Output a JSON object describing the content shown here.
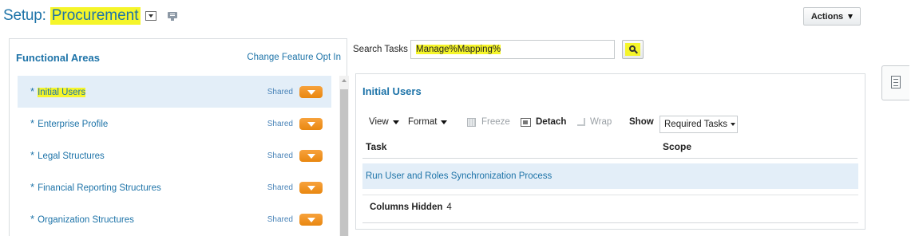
{
  "header": {
    "title_prefix": "Setup:",
    "title_name": "Procurement",
    "actions_label": "Actions"
  },
  "functional_areas": {
    "title": "Functional Areas",
    "change_link": "Change Feature Opt In",
    "items": [
      {
        "star": "*",
        "label": "Initial Users",
        "shared": "Shared",
        "selected": true
      },
      {
        "star": "*",
        "label": "Enterprise Profile",
        "shared": "Shared",
        "selected": false
      },
      {
        "star": "*",
        "label": "Legal Structures",
        "shared": "Shared",
        "selected": false
      },
      {
        "star": "*",
        "label": "Financial Reporting Structures",
        "shared": "Shared",
        "selected": false
      },
      {
        "star": "*",
        "label": "Organization Structures",
        "shared": "Shared",
        "selected": false
      }
    ]
  },
  "search": {
    "label": "Search Tasks",
    "value": "Manage%Mapping%"
  },
  "tasks_panel": {
    "title": "Initial Users",
    "toolbar": {
      "view": "View",
      "format": "Format",
      "freeze": "Freeze",
      "detach": "Detach",
      "wrap": "Wrap",
      "show": "Show",
      "show_value": "Required Tasks"
    },
    "columns": [
      "Task",
      "Scope"
    ],
    "rows": [
      {
        "task": "Run User and Roles Synchronization Process",
        "scope": ""
      }
    ],
    "columns_hidden_label": "Columns Hidden",
    "columns_hidden_count": "4"
  },
  "colors": {
    "link_blue": "#1d73a8",
    "highlight_yellow": "#f5f52a",
    "accent_orange": "#f29420",
    "selected_row": "#e3eef8"
  },
  "icons": [
    "dropdown-icon",
    "dashboard-icon",
    "search-icon",
    "freeze-icon",
    "detach-icon",
    "wrap-icon",
    "document-icon"
  ]
}
